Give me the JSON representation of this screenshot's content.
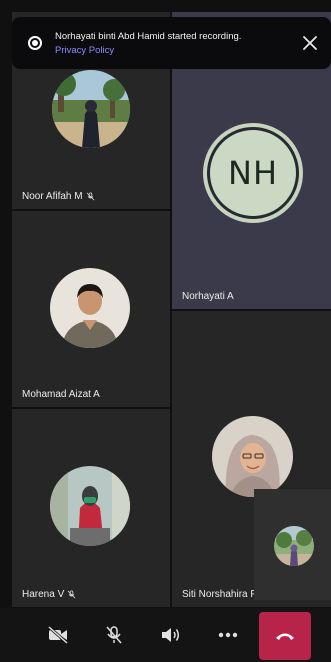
{
  "recording_banner": {
    "message": "Norhayati binti Abd Hamid started recording.",
    "link": "Privacy Policy",
    "icon": "recording-icon",
    "close_icon": "close-icon"
  },
  "participants": [
    {
      "name": "Noor Afifah M",
      "muted": true
    },
    {
      "name": "Norhayati A",
      "initials": "NH",
      "muted": false
    },
    {
      "name": "Mohamad Aizat A",
      "muted": false
    },
    {
      "name": "Siti Norshahira F",
      "muted": false
    },
    {
      "name": "Harena V",
      "muted": true
    }
  ],
  "call_controls": [
    {
      "icon": "video-off-icon"
    },
    {
      "icon": "mic-off-icon"
    },
    {
      "icon": "speaker-icon"
    },
    {
      "icon": "more-options-icon"
    },
    {
      "icon": "hang-up-icon"
    }
  ],
  "colors": {
    "active_tile": "#3b3a4a",
    "hangup": "#b8234a",
    "link": "#8b8cff",
    "nh_avatar": "#cbd8c4"
  }
}
